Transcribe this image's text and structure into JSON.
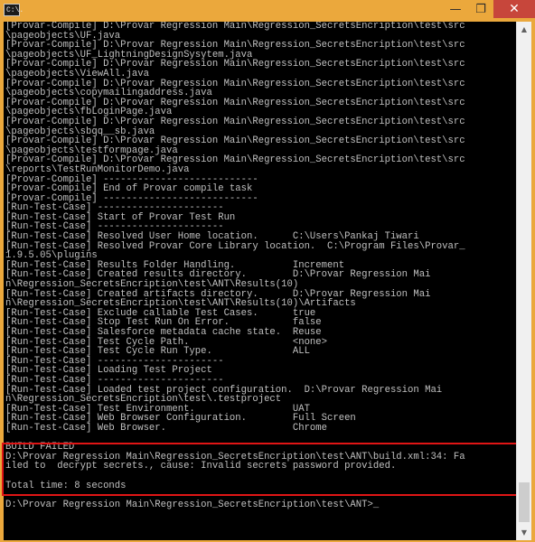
{
  "window": {
    "icon_text": "C:\\.",
    "title": "",
    "controls": {
      "minimize": "—",
      "maximize": "❐",
      "close": "✕"
    }
  },
  "console": {
    "lines": [
      "[Provar-Compile] D:\\Provar Regression Main\\Regression_SecretsEncription\\test\\src",
      "\\pageobjects\\UF.java",
      "[Provar-Compile] D:\\Provar Regression Main\\Regression_SecretsEncription\\test\\src",
      "\\pageobjects\\UF_LightningDesignSysytem.java",
      "[Provar-Compile] D:\\Provar Regression Main\\Regression_SecretsEncription\\test\\src",
      "\\pageobjects\\ViewAll.java",
      "[Provar-Compile] D:\\Provar Regression Main\\Regression_SecretsEncription\\test\\src",
      "\\pageobjects\\copymailingaddress.java",
      "[Provar-Compile] D:\\Provar Regression Main\\Regression_SecretsEncription\\test\\src",
      "\\pageobjects\\fbLoginPage.java",
      "[Provar-Compile] D:\\Provar Regression Main\\Regression_SecretsEncription\\test\\src",
      "\\pageobjects\\sbqq__sb.java",
      "[Provar-Compile] D:\\Provar Regression Main\\Regression_SecretsEncription\\test\\src",
      "\\pageobjects\\testformpage.java",
      "[Provar-Compile] D:\\Provar Regression Main\\Regression_SecretsEncription\\test\\src",
      "\\reports\\TestRunMonitorDemo.java",
      "[Provar-Compile] ---------------------------",
      "[Provar-Compile] End of Provar compile task",
      "[Provar-Compile] ---------------------------",
      "[Run-Test-Case] ----------------------",
      "[Run-Test-Case] Start of Provar Test Run",
      "[Run-Test-Case] ----------------------",
      "[Run-Test-Case] Resolved User Home location.      C:\\Users\\Pankaj Tiwari",
      "[Run-Test-Case] Resolved Provar Core Library location.  C:\\Program Files\\Provar_",
      "1.9.5.05\\plugins",
      "[Run-Test-Case] Results Folder Handling.          Increment",
      "[Run-Test-Case] Created results directory.        D:\\Provar Regression Mai",
      "n\\Regression_SecretsEncription\\test\\ANT\\Results(10)",
      "[Run-Test-Case] Created artifacts directory.      D:\\Provar Regression Mai",
      "n\\Regression_SecretsEncription\\test\\ANT\\Results(10)\\Artifacts",
      "[Run-Test-Case] Exclude callable Test Cases.      true",
      "[Run-Test-Case] Stop Test Run On Error.           false",
      "[Run-Test-Case] Salesforce metadata cache state.  Reuse",
      "[Run-Test-Case] Test Cycle Path.                  <none>",
      "[Run-Test-Case] Test Cycle Run Type.              ALL",
      "[Run-Test-Case] ----------------------",
      "[Run-Test-Case] Loading Test Project",
      "[Run-Test-Case] ----------------------",
      "[Run-Test-Case] Loaded test project configuration.  D:\\Provar Regression Mai",
      "n\\Regression_SecretsEncription\\test\\.testproject",
      "[Run-Test-Case] Test Environment.                 UAT",
      "[Run-Test-Case] Web Browser Configuration.        Full Screen",
      "[Run-Test-Case] Web Browser.                      Chrome",
      "",
      "BUILD FAILED",
      "D:\\Provar Regression Main\\Regression_SecretsEncription\\test\\ANT\\build.xml:34: Fa",
      "iled to  decrypt secrets., cause: Invalid secrets password provided.",
      "",
      "Total time: 8 seconds",
      "",
      "D:\\Provar Regression Main\\Regression_SecretsEncription\\test\\ANT>_"
    ]
  },
  "scrollbar": {
    "up_arrow": "▲",
    "down_arrow": "▼",
    "position_fraction": 0.96
  },
  "colors": {
    "frame": "#eba83c",
    "console_bg": "#000000",
    "console_text": "#c0c0c0",
    "highlight_border": "#e01515",
    "close_button": "#c7463b"
  }
}
